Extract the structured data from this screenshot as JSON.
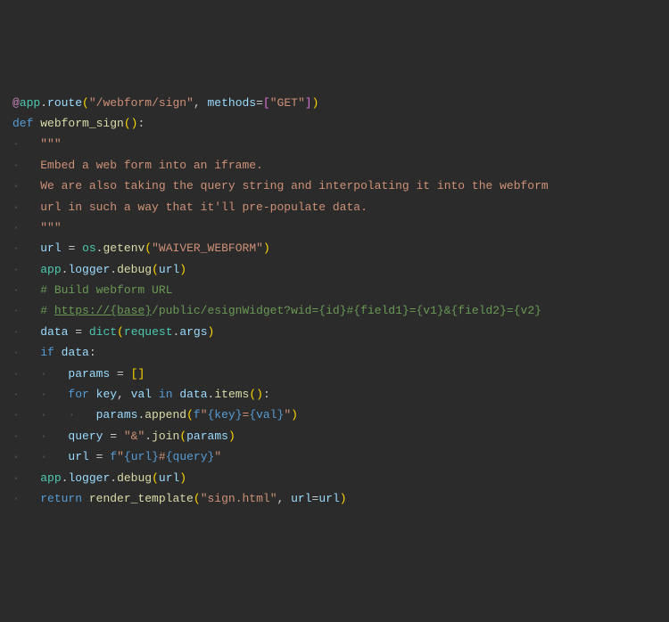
{
  "code": {
    "decorator_at": "@",
    "app": "app",
    "dot": ".",
    "route_method": "route",
    "route_path": "\"/webform/sign\"",
    "methods_kw": "methods",
    "equals": "=",
    "methods_list_open": "[",
    "get_str": "\"GET\"",
    "methods_list_close": "]",
    "def_kw": "def",
    "func_name": "webform_sign",
    "empty_parens": "()",
    "colon": ":",
    "triple_quote": "\"\"\"",
    "doc1": "Embed a web form into an iframe.",
    "doc2": "We are also taking the query string and interpolating it into the webform",
    "doc3": "url in such a way that it'll pre-populate data.",
    "url_var": "url",
    "os_obj": "os",
    "getenv": "getenv",
    "waiver_str": "\"WAIVER_WEBFORM\"",
    "logger": "logger",
    "debug": "debug",
    "url_arg": "url",
    "comment_build": "# Build webform URL",
    "comment_hash": "# ",
    "comment_url_scheme": "https://{base}",
    "comment_url_rest": "/public/esignWidget?wid={id}#{field1}={v1}&{field2}={v2}",
    "data_var": "data",
    "dict_fn": "dict",
    "request_obj": "request",
    "args_attr": "args",
    "if_kw": "if",
    "params_var": "params",
    "empty_list": "[]",
    "for_kw": "for",
    "key_var": "key",
    "comma": ",",
    "val_var": "val",
    "in_kw": "in",
    "items_method": "items",
    "append_method": "append",
    "f_prefix": "f",
    "fstr1_open": "\"",
    "fstr1_key": "{key}",
    "fstr1_eq": "=",
    "fstr1_val": "{val}",
    "fstr1_close": "\"",
    "query_var": "query",
    "amp_str": "\"&\"",
    "join_method": "join",
    "params_arg": "params",
    "fstr2_url": "{url}",
    "fstr2_hash": "#",
    "fstr2_query": "{query}",
    "return_kw": "return",
    "render_template": "render_template",
    "sign_html": "\"sign.html\"",
    "url_kw": "url",
    "space": " ",
    "guide1": "····",
    "guide2": "····",
    "guide_indent1": "    ",
    "guide_dots2": "····"
  }
}
